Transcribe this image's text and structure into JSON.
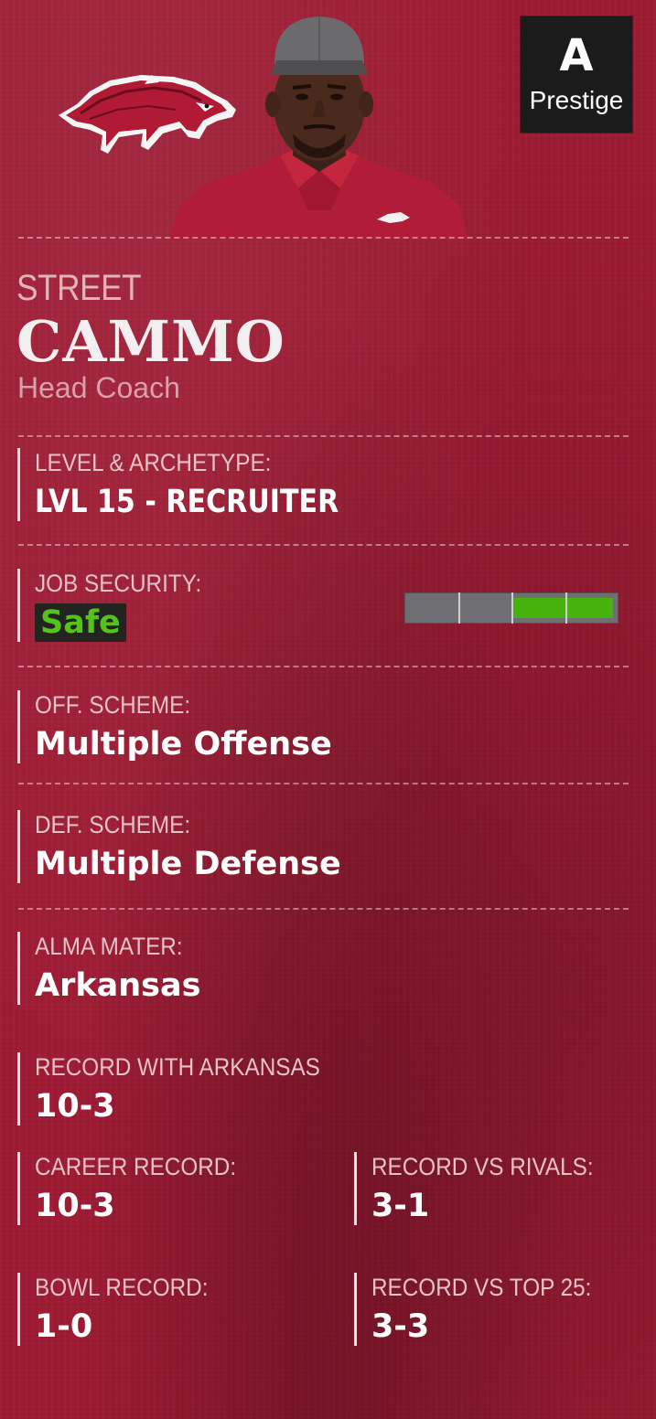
{
  "prestige": {
    "grade": "A",
    "label": "Prestige"
  },
  "coach": {
    "first_name": "STREET",
    "last_name": "CAMMO",
    "title": "Head Coach"
  },
  "fields": {
    "level_archetype": {
      "label": "LEVEL & ARCHETYPE:",
      "value": "LVL 15 - RECRUITER"
    },
    "job_security": {
      "label": "JOB SECURITY:",
      "value": "Safe",
      "level": 0.5,
      "segments": 4
    },
    "off_scheme": {
      "label": "OFF. SCHEME:",
      "value": "Multiple Offense"
    },
    "def_scheme": {
      "label": "DEF. SCHEME:",
      "value": "Multiple Defense"
    },
    "alma_mater": {
      "label": "ALMA MATER:",
      "value": "Arkansas"
    },
    "record_with_team": {
      "label": "RECORD WITH ARKANSAS",
      "value": "10-3"
    },
    "career_record": {
      "label": "CAREER RECORD:",
      "value": "10-3"
    },
    "record_vs_rivals": {
      "label": "RECORD VS RIVALS:",
      "value": "3-1"
    },
    "bowl_record": {
      "label": "BOWL RECORD:",
      "value": "1-0"
    },
    "record_vs_top25": {
      "label": "RECORD VS TOP 25:",
      "value": "3-3"
    }
  },
  "icons": {
    "logo": "razorback-hog-icon",
    "portrait": "coach-portrait"
  },
  "colors": {
    "background": "#9d1b33",
    "safe_green": "#52c41a",
    "bar_green": "#48b20d",
    "bar_gray": "#6f6f73",
    "badge_black": "#1b1b1b"
  }
}
